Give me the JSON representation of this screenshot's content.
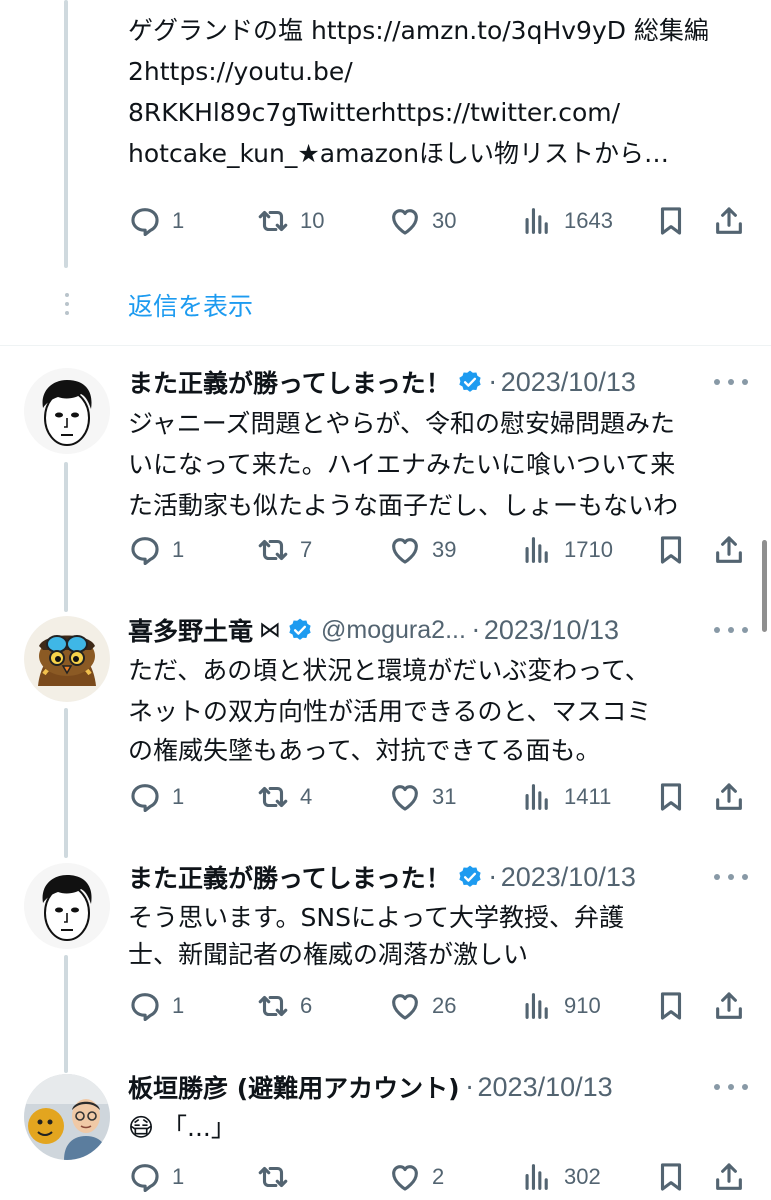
{
  "top_tweet": {
    "lines": [
      "ゲグランドの塩 https://amzn.to/3qHv9yD 総集編",
      "2https://youtu.be/",
      "8RKKHl89c7gTwitterhttps://twitter.com/",
      "hotcake_kun_★amazonほしい物リストから…"
    ],
    "replies": "1",
    "retweets": "10",
    "likes": "30",
    "views": "1643"
  },
  "show_replies_label": "返信を表示",
  "tweets": [
    {
      "name": "また正義が勝ってしまった！",
      "verified": true,
      "handle": "",
      "date": "2023/10/13",
      "lines": [
        "ジャニーズ問題とやらが、令和の慰安婦問題みた",
        "いになって来た。ハイエナみたいに喰いついて来",
        "た活動家も似たような面子だし、しょーもないわ"
      ],
      "replies": "1",
      "retweets": "7",
      "likes": "39",
      "views": "1710"
    },
    {
      "name": "喜多野土竜",
      "name_extra": "⋈",
      "verified": true,
      "handle": "@mogura2...",
      "date": "2023/10/13",
      "lines": [
        "ただ、あの頃と状況と環境がだいぶ変わって、",
        "ネットの双方向性が活用できるのと、マスコミ",
        "の権威失墜もあって、対抗できてる面も。"
      ],
      "replies": "1",
      "retweets": "4",
      "likes": "31",
      "views": "1411"
    },
    {
      "name": "また正義が勝ってしまった！",
      "verified": true,
      "handle": "",
      "date": "2023/10/13",
      "lines": [
        "そう思います。SNSによって大学教授、弁護",
        "士、新聞記者の権威の凋落が激しい"
      ],
      "replies": "1",
      "retweets": "6",
      "likes": "26",
      "views": "910"
    },
    {
      "name": "板垣勝彦 (避難用アカウント)",
      "verified": false,
      "handle": "",
      "date": "2023/10/13",
      "lines": [
        "😷 「...」"
      ],
      "replies": "1",
      "retweets": "",
      "likes": "2",
      "views": "302"
    }
  ],
  "separator": "·",
  "colors": {
    "accent": "#1d9bf0",
    "text": "#0f1419",
    "muted": "#536471",
    "thread": "#cfd9de"
  },
  "icons": [
    "reply-icon",
    "retweet-icon",
    "like-icon",
    "views-icon",
    "bookmark-icon",
    "share-icon",
    "verified-badge-icon",
    "more-icon"
  ]
}
